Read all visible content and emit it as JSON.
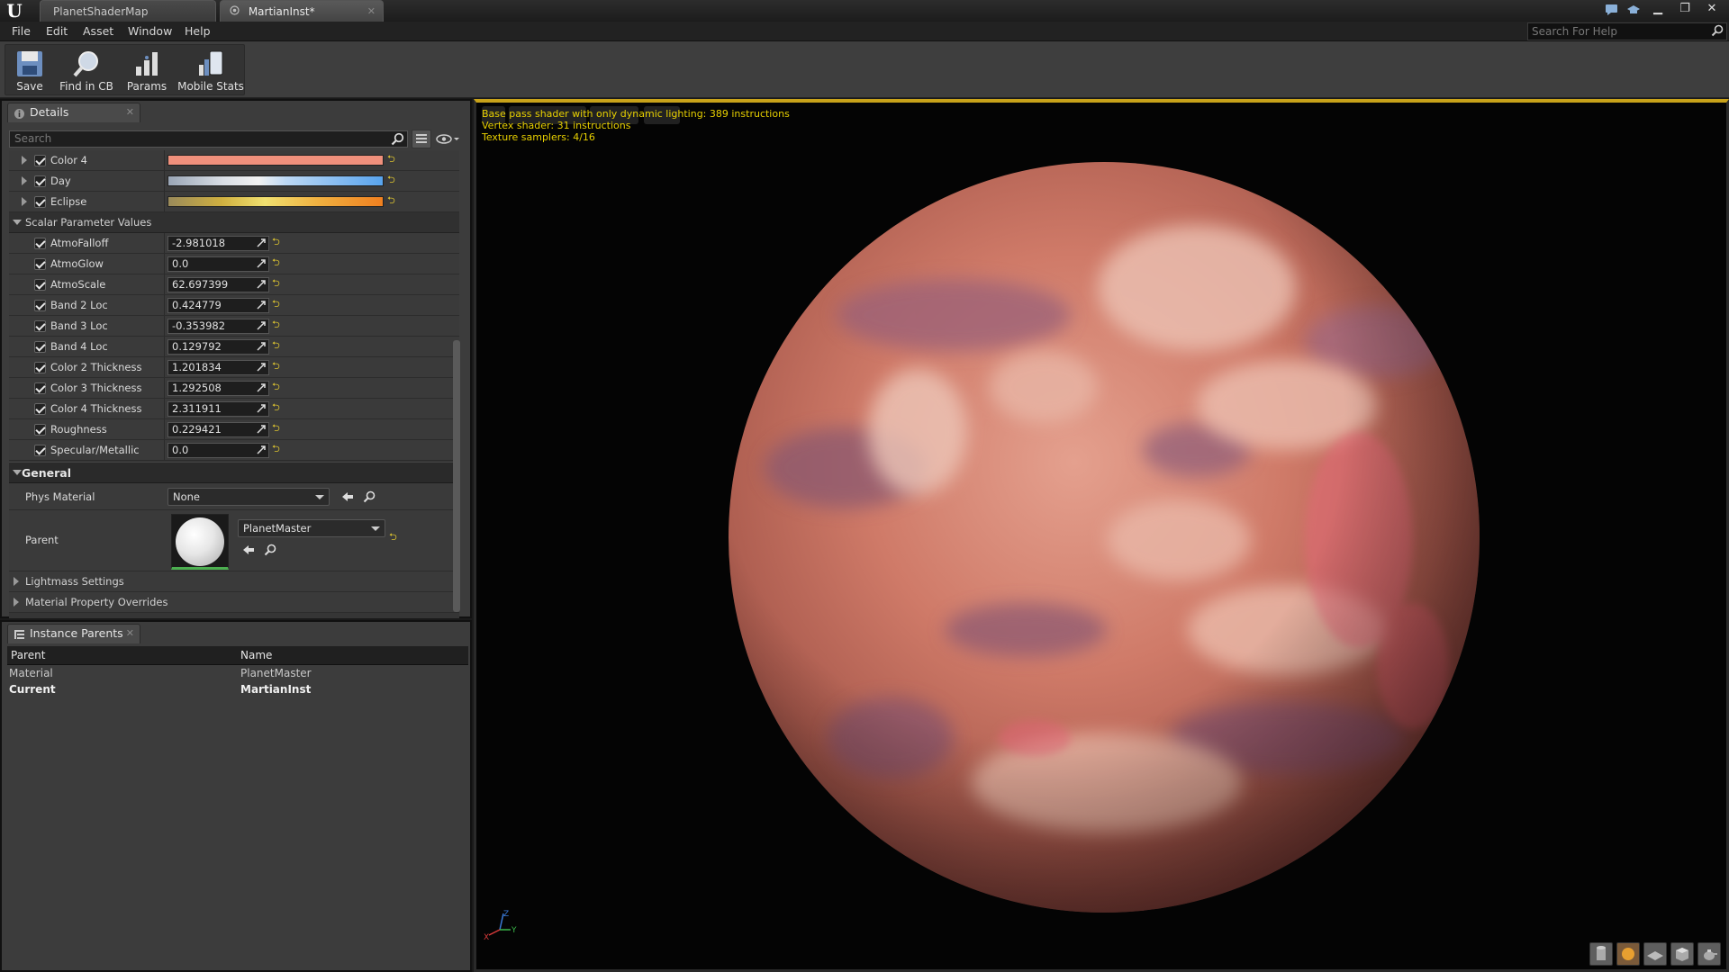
{
  "titlebar": {
    "tabs": [
      {
        "label": "PlanetShaderMap"
      },
      {
        "label": "MartianInst*"
      }
    ]
  },
  "menu": {
    "items": [
      "File",
      "Edit",
      "Asset",
      "Window",
      "Help"
    ],
    "help_search_placeholder": "Search For Help"
  },
  "toolbar": {
    "buttons": [
      {
        "label": "Save",
        "icon": "save-icon"
      },
      {
        "label": "Find in CB",
        "icon": "find-in-cb-icon"
      },
      {
        "label": "Params",
        "icon": "params-icon"
      },
      {
        "label": "Mobile Stats",
        "icon": "mobile-stats-icon"
      }
    ]
  },
  "details": {
    "tab_label": "Details",
    "search_placeholder": "Search",
    "vector_params": [
      {
        "label": "Color 4",
        "checked": true
      },
      {
        "label": "Day",
        "checked": true
      },
      {
        "label": "Eclipse",
        "checked": true
      }
    ],
    "scalar_section_label": "Scalar Parameter Values",
    "scalar_params": [
      {
        "label": "AtmoFalloff",
        "value": "-2.981018",
        "checked": true
      },
      {
        "label": "AtmoGlow",
        "value": "0.0",
        "checked": true
      },
      {
        "label": "AtmoScale",
        "value": "62.697399",
        "checked": true
      },
      {
        "label": "Band 2 Loc",
        "value": "0.424779",
        "checked": true
      },
      {
        "label": "Band 3 Loc",
        "value": "-0.353982",
        "checked": true
      },
      {
        "label": "Band 4 Loc",
        "value": "0.129792",
        "checked": true
      },
      {
        "label": "Color 2 Thickness",
        "value": "1.201834",
        "checked": true
      },
      {
        "label": "Color 3 Thickness",
        "value": "1.292508",
        "checked": true
      },
      {
        "label": "Color 4 Thickness",
        "value": "2.311911",
        "checked": true
      },
      {
        "label": "Roughness",
        "value": "0.229421",
        "checked": true
      },
      {
        "label": "Specular/Metallic",
        "value": "0.0",
        "checked": true
      }
    ],
    "general": {
      "label": "General",
      "phys_material_label": "Phys Material",
      "phys_material_value": "None",
      "parent_label": "Parent",
      "parent_value": "PlanetMaster"
    },
    "collapsed_sections": [
      "Lightmass Settings",
      "Material Property Overrides"
    ]
  },
  "instance_parents": {
    "tab_label": "Instance Parents",
    "columns": [
      "Parent",
      "Name"
    ],
    "rows": [
      {
        "parent": "Material",
        "name": "PlanetMaster",
        "bold": false
      },
      {
        "parent": "Current",
        "name": "MartianInst",
        "bold": true
      }
    ]
  },
  "viewport": {
    "stats": [
      "Base pass shader with only dynamic lighting: 389 instructions",
      "Vertex shader: 31 instructions",
      "Texture samplers: 4/16"
    ],
    "axis_labels": {
      "x": "X",
      "y": "Y",
      "z": "Z"
    }
  },
  "colors": {
    "accent_yellow": "#c8a21a",
    "stats_text": "#e8d000",
    "planet_base": "#c8705e"
  }
}
